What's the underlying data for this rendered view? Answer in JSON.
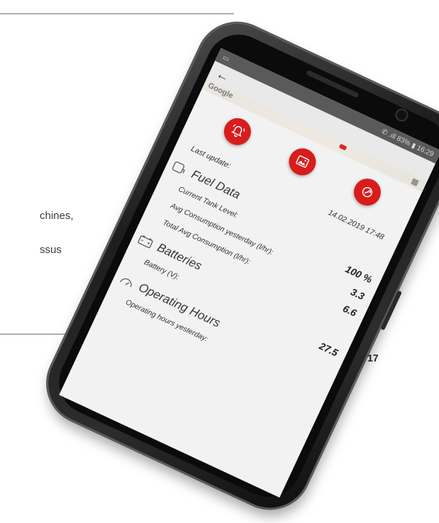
{
  "page": {
    "text_line_1": "chines,",
    "text_line_2": "ssus",
    "page_number": "17"
  },
  "phone": {
    "status_bar": {
      "left": "▭",
      "right": "✆ .ıll 83% ▮ 16:29"
    },
    "app_bar": {
      "back_icon": "back-arrow-icon",
      "map_label": "Google"
    },
    "action_icons": [
      {
        "name": "alarm-bell-icon"
      },
      {
        "name": "image-icon"
      },
      {
        "name": "wrench-settings-icon"
      }
    ],
    "last_update": {
      "label": "Last update:",
      "value": "14.02.2019 17:48"
    },
    "fuel": {
      "title": "Fuel Data",
      "rows": [
        {
          "label": "Current Tank Level:",
          "value": "100 %"
        },
        {
          "label": "Avg Consumption yesterday (l/hr):",
          "value": "3.3"
        },
        {
          "label": "Total Avg Consumption (l/hr):",
          "value": "6.6"
        }
      ]
    },
    "batteries": {
      "title": "Batteries",
      "rows": [
        {
          "label": "Battery (V):",
          "value": "27.5"
        }
      ]
    },
    "operating": {
      "title": "Operating Hours",
      "rows": [
        {
          "label": "Operating hours yesterday:",
          "value": ""
        }
      ]
    }
  },
  "colors": {
    "accent_red": "#d91c1c"
  }
}
